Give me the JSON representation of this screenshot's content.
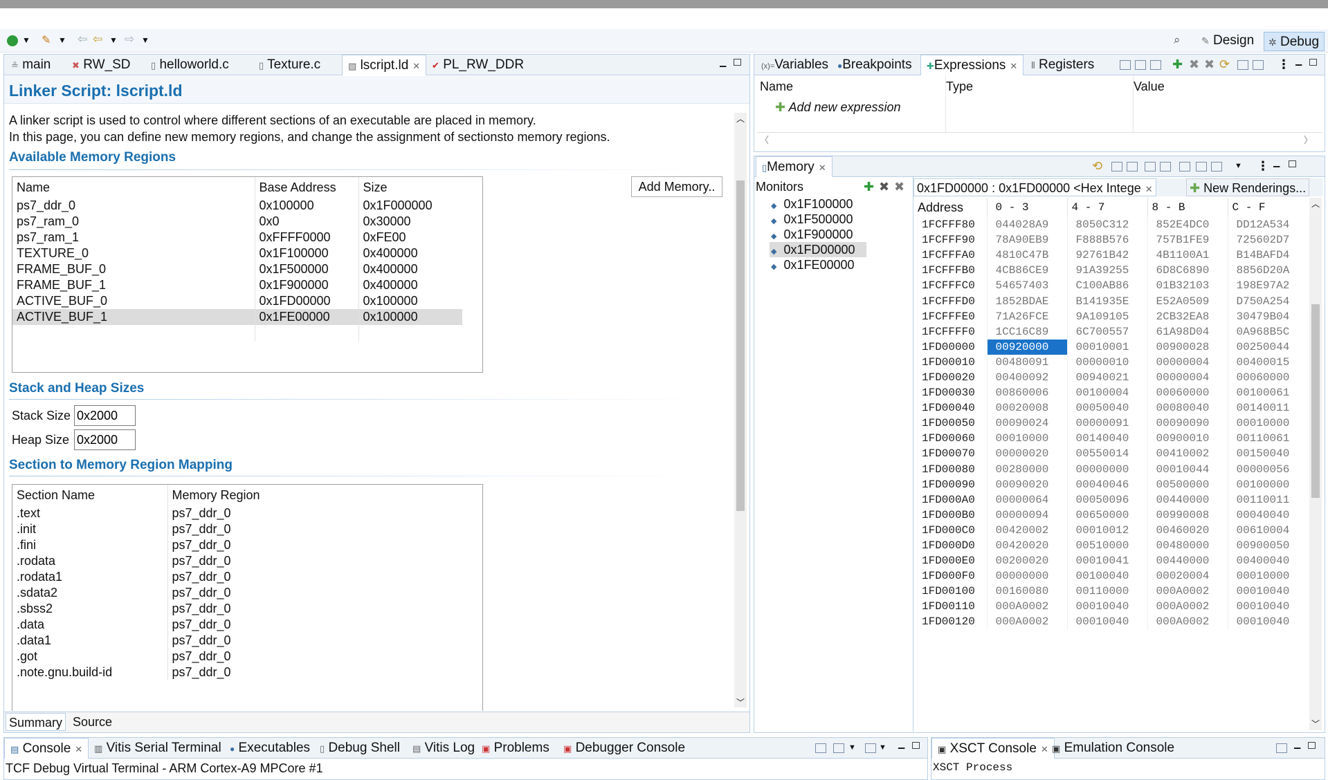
{
  "toolbar": {
    "debug_perspective": "Debug",
    "design_perspective": "Design"
  },
  "editor_tabs": [
    "main",
    "RW_SD",
    "helloworld.c",
    "Texture.c",
    "lscript.ld",
    "PL_RW_DDR"
  ],
  "linker": {
    "title": "Linker Script: lscript.ld",
    "desc1": "A linker script is used to control where different sections of an executable are placed in memory.",
    "desc2": "In this page, you can define new memory regions, and change the assignment of sectionsto memory regions.",
    "regions_heading": "Available Memory Regions",
    "regions_headers": [
      "Name",
      "Base Address",
      "Size"
    ],
    "regions": [
      {
        "name": "ps7_ddr_0",
        "base": "0x100000",
        "size": "0x1F000000"
      },
      {
        "name": "ps7_ram_0",
        "base": "0x0",
        "size": "0x30000"
      },
      {
        "name": "ps7_ram_1",
        "base": "0xFFFF0000",
        "size": "0xFE00"
      },
      {
        "name": "TEXTURE_0",
        "base": "0x1F100000",
        "size": "0x400000"
      },
      {
        "name": "FRAME_BUF_0",
        "base": "0x1F500000",
        "size": "0x400000"
      },
      {
        "name": "FRAME_BUF_1",
        "base": "0x1F900000",
        "size": "0x400000"
      },
      {
        "name": "ACTIVE_BUF_0",
        "base": "0x1FD00000",
        "size": "0x100000"
      },
      {
        "name": "ACTIVE_BUF_1",
        "base": "0x1FE00000",
        "size": "0x100000"
      }
    ],
    "add_memory": "Add Memory..",
    "stack_heading": "Stack and Heap Sizes",
    "stack_label": "Stack Size",
    "stack_value": "0x2000",
    "heap_label": "Heap Size",
    "heap_value": "0x2000",
    "mapping_heading": "Section to Memory Region Mapping",
    "mapping_headers": [
      "Section Name",
      "Memory Region"
    ],
    "mapping": [
      {
        "section": ".text",
        "region": "ps7_ddr_0"
      },
      {
        "section": ".init",
        "region": "ps7_ddr_0"
      },
      {
        "section": ".fini",
        "region": "ps7_ddr_0"
      },
      {
        "section": ".rodata",
        "region": "ps7_ddr_0"
      },
      {
        "section": ".rodata1",
        "region": "ps7_ddr_0"
      },
      {
        "section": ".sdata2",
        "region": "ps7_ddr_0"
      },
      {
        "section": ".sbss2",
        "region": "ps7_ddr_0"
      },
      {
        "section": ".data",
        "region": "ps7_ddr_0"
      },
      {
        "section": ".data1",
        "region": "ps7_ddr_0"
      },
      {
        "section": ".got",
        "region": "ps7_ddr_0"
      },
      {
        "section": ".note.gnu.build-id",
        "region": "ps7_ddr_0"
      }
    ],
    "bottom_tabs": [
      "Summary",
      "Source"
    ]
  },
  "expr_view": {
    "tabs": [
      "Variables",
      "Breakpoints",
      "Expressions",
      "Registers"
    ],
    "headers": [
      "Name",
      "Type",
      "Value"
    ],
    "add_expr": "Add new expression"
  },
  "memory_view": {
    "tab": "Memory",
    "monitors_label": "Monitors",
    "monitors": [
      "0x1F100000",
      "0x1F500000",
      "0x1F900000",
      "0x1FD00000",
      "0x1FE00000"
    ],
    "rendering_tab": "0x1FD00000 : 0x1FD00000 <Hex Intege",
    "new_renderings": "New Renderings...",
    "headers": [
      "Address",
      "0 - 3",
      "4 - 7",
      "8 - B",
      "C - F"
    ],
    "rows": [
      [
        "1FCFFF80",
        "044028A9",
        "8050C312",
        "852E4DC0",
        "DD12A534"
      ],
      [
        "1FCFFF90",
        "78A90EB9",
        "F888B576",
        "757B1FE9",
        "725602D7"
      ],
      [
        "1FCFFFA0",
        "4810C47B",
        "92761B42",
        "4B1100A1",
        "B14BAFD4"
      ],
      [
        "1FCFFFB0",
        "4CB86CE9",
        "91A39255",
        "6D8C6890",
        "8856D20A"
      ],
      [
        "1FCFFFC0",
        "54657403",
        "C100AB86",
        "01B32103",
        "198E97A2"
      ],
      [
        "1FCFFFD0",
        "1852BDAE",
        "B141935E",
        "E52A0509",
        "D750A254"
      ],
      [
        "1FCFFFE0",
        "71A26FCE",
        "9A109105",
        "2CB32EA8",
        "30479B04"
      ],
      [
        "1FCFFFF0",
        "1CC16C89",
        "6C700557",
        "61A98D04",
        "0A968B5C"
      ],
      [
        "1FD00000",
        "00920000",
        "00010001",
        "00900028",
        "00250044"
      ],
      [
        "1FD00010",
        "00480091",
        "00000010",
        "00000004",
        "00400015"
      ],
      [
        "1FD00020",
        "00400092",
        "00940021",
        "00000004",
        "00060000"
      ],
      [
        "1FD00030",
        "00860006",
        "00100004",
        "00060000",
        "00100061"
      ],
      [
        "1FD00040",
        "00020008",
        "00050040",
        "00080040",
        "00140011"
      ],
      [
        "1FD00050",
        "00090024",
        "00000091",
        "00090090",
        "00010000"
      ],
      [
        "1FD00060",
        "00010000",
        "00140040",
        "00900010",
        "00110061"
      ],
      [
        "1FD00070",
        "00000020",
        "00550014",
        "00410002",
        "00150040"
      ],
      [
        "1FD00080",
        "00280000",
        "00000000",
        "00010044",
        "00000056"
      ],
      [
        "1FD00090",
        "00090020",
        "00040046",
        "00500000",
        "00100000"
      ],
      [
        "1FD000A0",
        "00000064",
        "00050096",
        "00440000",
        "00110011"
      ],
      [
        "1FD000B0",
        "00000094",
        "00650000",
        "00990008",
        "00040040"
      ],
      [
        "1FD000C0",
        "00420002",
        "00010012",
        "00460020",
        "00610004"
      ],
      [
        "1FD000D0",
        "00420020",
        "00510000",
        "00480000",
        "00900050"
      ],
      [
        "1FD000E0",
        "00200020",
        "00010041",
        "00440000",
        "00400040"
      ],
      [
        "1FD000F0",
        "00000000",
        "00100040",
        "00020004",
        "00010000"
      ],
      [
        "1FD00100",
        "00160080",
        "00110000",
        "000A0002",
        "00010040"
      ],
      [
        "1FD00110",
        "000A0002",
        "00010040",
        "000A0002",
        "00010040"
      ],
      [
        "1FD00120",
        "000A0002",
        "00010040",
        "000A0002",
        "00010040"
      ]
    ]
  },
  "console": {
    "tabs": [
      "Console",
      "Vitis Serial Terminal",
      "Executables",
      "Debug Shell",
      "Vitis Log",
      "Problems",
      "Debugger Console"
    ],
    "line": "TCF Debug Virtual Terminal - ARM Cortex-A9 MPCore #1",
    "right_tabs": [
      "XSCT Console",
      "Emulation Console"
    ],
    "xsct_line": "XSCT Process"
  }
}
